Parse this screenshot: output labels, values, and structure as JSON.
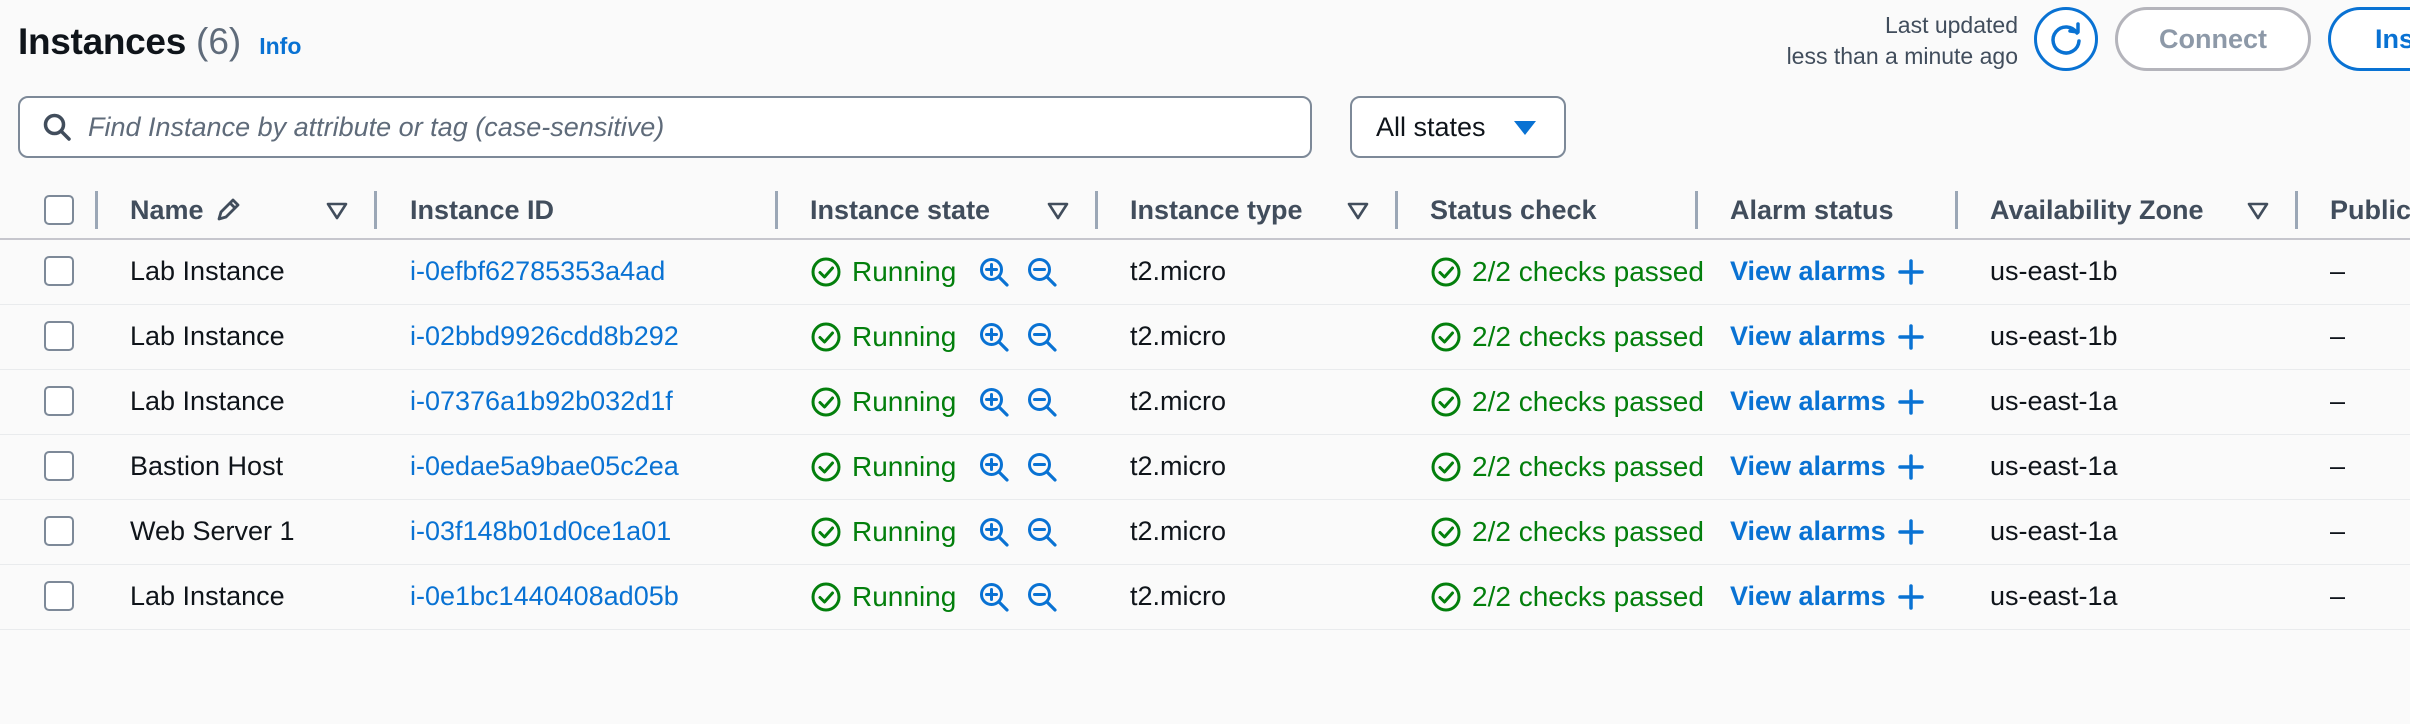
{
  "header": {
    "title": "Instances",
    "count": "(6)",
    "info_label": "Info",
    "last_updated_line1": "Last updated",
    "last_updated_line2": "less than a minute ago",
    "connect_label": "Connect",
    "instance_state_label": "Ins"
  },
  "search": {
    "placeholder": "Find Instance by attribute or tag (case-sensitive)",
    "value": ""
  },
  "states_filter": {
    "selected": "All states"
  },
  "columns": [
    "Name",
    "Instance ID",
    "Instance state",
    "Instance type",
    "Status check",
    "Alarm status",
    "Availability Zone",
    "Public"
  ],
  "rows": [
    {
      "name": "Lab Instance",
      "instance_id": "i-0efbf62785353a4ad",
      "state": "Running",
      "type": "t2.micro",
      "status_check": "2/2 checks passed",
      "alarm": "View alarms",
      "az": "us-east-1b",
      "public": "–"
    },
    {
      "name": "Lab Instance",
      "instance_id": "i-02bbd9926cdd8b292",
      "state": "Running",
      "type": "t2.micro",
      "status_check": "2/2 checks passed",
      "alarm": "View alarms",
      "az": "us-east-1b",
      "public": "–"
    },
    {
      "name": "Lab Instance",
      "instance_id": "i-07376a1b92b032d1f",
      "state": "Running",
      "type": "t2.micro",
      "status_check": "2/2 checks passed",
      "alarm": "View alarms",
      "az": "us-east-1a",
      "public": "–"
    },
    {
      "name": "Bastion Host",
      "instance_id": "i-0edae5a9bae05c2ea",
      "state": "Running",
      "type": "t2.micro",
      "status_check": "2/2 checks passed",
      "alarm": "View alarms",
      "az": "us-east-1a",
      "public": "–"
    },
    {
      "name": "Web Server 1",
      "instance_id": "i-03f148b01d0ce1a01",
      "state": "Running",
      "type": "t2.micro",
      "status_check": "2/2 checks passed",
      "alarm": "View alarms",
      "az": "us-east-1a",
      "public": "–"
    },
    {
      "name": "Lab Instance",
      "instance_id": "i-0e1bc1440408ad05b",
      "state": "Running",
      "type": "t2.micro",
      "status_check": "2/2 checks passed",
      "alarm": "View alarms",
      "az": "us-east-1a",
      "public": "–"
    }
  ],
  "colors": {
    "link": "#0972d3",
    "success": "#037f0c",
    "text": "#0f141a",
    "muted": "#5f6b7a"
  }
}
